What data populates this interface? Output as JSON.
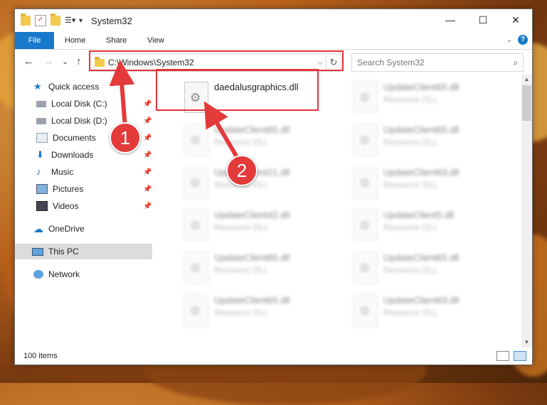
{
  "window": {
    "title": "System32",
    "controls": {
      "minimize": "—",
      "maximize": "☐",
      "close": "✕"
    }
  },
  "ribbon": {
    "tabs": [
      "File",
      "Home",
      "Share",
      "View"
    ]
  },
  "nav": {
    "back": "←",
    "forward": "→",
    "recent": "⌄",
    "up": "↑",
    "address": "C:\\Windows\\System32",
    "search_placeholder": "Search System32"
  },
  "sidebar": {
    "items": [
      {
        "label": "Quick access",
        "icon": "star-icon"
      },
      {
        "label": "Local Disk (C:)",
        "icon": "drive-icon",
        "pinned": true
      },
      {
        "label": "Local Disk (D:)",
        "icon": "drive-icon",
        "pinned": true
      },
      {
        "label": "Documents",
        "icon": "documents-icon",
        "pinned": true
      },
      {
        "label": "Downloads",
        "icon": "download-icon",
        "pinned": true
      },
      {
        "label": "Music",
        "icon": "music-icon",
        "pinned": true
      },
      {
        "label": "Pictures",
        "icon": "pictures-icon",
        "pinned": true
      },
      {
        "label": "Videos",
        "icon": "videos-icon",
        "pinned": true
      },
      {
        "label": "OneDrive",
        "icon": "cloud-icon"
      },
      {
        "label": "This PC",
        "icon": "pc-icon",
        "selected": true
      },
      {
        "label": "Network",
        "icon": "network-icon"
      }
    ]
  },
  "files": [
    {
      "name": "daedalusgraphics.dll",
      "type": "",
      "clear": true
    },
    {
      "name": "UpdateClient65.dll",
      "type": "Resource DLL"
    },
    {
      "name": "UpdateClient65.dll",
      "type": "Resource DLL"
    },
    {
      "name": "UpdateClient65.dll",
      "type": "Resource DLL"
    },
    {
      "name": "UpdateClient21.dll",
      "type": "Resource DLL"
    },
    {
      "name": "UpdateClient63.dll",
      "type": "Resource DLL"
    },
    {
      "name": "UpdateClient42.dll",
      "type": "Resource DLL"
    },
    {
      "name": "UpdateClient5.dll",
      "type": "Resource DLL"
    },
    {
      "name": "UpdateClient65.dll",
      "type": "Resource DLL"
    },
    {
      "name": "UpdateClient65.dll",
      "type": "Resource DLL"
    },
    {
      "name": "UpdateClient65.dll",
      "type": "Resource DLL"
    },
    {
      "name": "UpdateClient63.dll",
      "type": "Resource DLL"
    }
  ],
  "status": {
    "item_count": "100 items"
  },
  "annotations": {
    "step1": "1",
    "step2": "2",
    "color": "#e3333a"
  }
}
